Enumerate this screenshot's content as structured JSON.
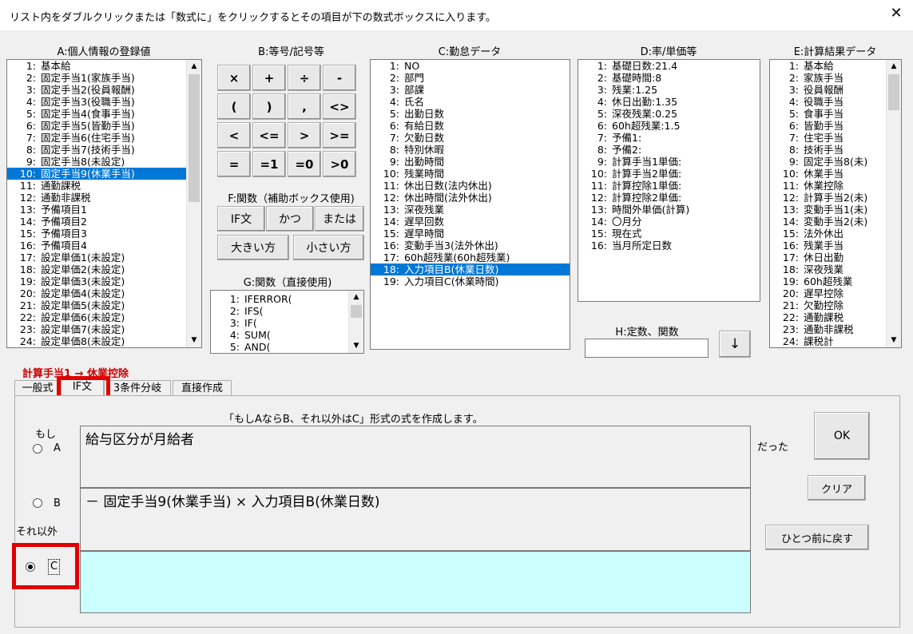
{
  "window": {
    "title": "リスト内をダブルクリックまたは「数式に」をクリックするとその項目が下の数式ボックスに入ります。",
    "close": "✕"
  },
  "headers": {
    "a": "A:個人情報の登録値",
    "b": "B:等号/記号等",
    "c": "C:勤怠データ",
    "d": "D:率/単価等",
    "e": "E:計算結果データ",
    "f": "F:関数（補助ボックス使用)",
    "g": "G:関数（直接使用)",
    "h": "H:定数、関数"
  },
  "list_a": [
    {
      "n": "1:",
      "t": "基本給"
    },
    {
      "n": "2:",
      "t": "固定手当1(家族手当)"
    },
    {
      "n": "3:",
      "t": "固定手当2(役員報酬)"
    },
    {
      "n": "4:",
      "t": "固定手当3(役職手当)"
    },
    {
      "n": "5:",
      "t": "固定手当4(食事手当)"
    },
    {
      "n": "6:",
      "t": "固定手当5(皆勤手当)"
    },
    {
      "n": "7:",
      "t": "固定手当6(住宅手当)"
    },
    {
      "n": "8:",
      "t": "固定手当7(技術手当)"
    },
    {
      "n": "9:",
      "t": "固定手当8(未設定)"
    },
    {
      "n": "10:",
      "t": "固定手当9(休業手当)"
    },
    {
      "n": "11:",
      "t": "通勤課税"
    },
    {
      "n": "12:",
      "t": "通勤非課税"
    },
    {
      "n": "13:",
      "t": "予備項目1"
    },
    {
      "n": "14:",
      "t": "予備項目2"
    },
    {
      "n": "15:",
      "t": "予備項目3"
    },
    {
      "n": "16:",
      "t": "予備項目4"
    },
    {
      "n": "17:",
      "t": "設定単価1(未設定)"
    },
    {
      "n": "18:",
      "t": "設定単価2(未設定)"
    },
    {
      "n": "19:",
      "t": "設定単価3(未設定)"
    },
    {
      "n": "20:",
      "t": "設定単価4(未設定)"
    },
    {
      "n": "21:",
      "t": "設定単価5(未設定)"
    },
    {
      "n": "22:",
      "t": "設定単価6(未設定)"
    },
    {
      "n": "23:",
      "t": "設定単価7(未設定)"
    },
    {
      "n": "24:",
      "t": "設定単価8(未設定)"
    }
  ],
  "list_a_selected": 9,
  "symbol_buttons": [
    "×",
    "+",
    "÷",
    "-",
    "(",
    ")",
    ",",
    "<>",
    "<",
    "<=",
    ">",
    ">=",
    "=",
    "=1",
    "=0",
    ">0"
  ],
  "func_buttons": [
    "IF文",
    "かつ",
    "または",
    "大きい方",
    "小さい方"
  ],
  "list_g": [
    {
      "n": "1:",
      "t": "IFERROR("
    },
    {
      "n": "2:",
      "t": "IFS("
    },
    {
      "n": "3:",
      "t": "IF("
    },
    {
      "n": "4:",
      "t": "SUM("
    },
    {
      "n": "5:",
      "t": "AND("
    }
  ],
  "list_c": [
    {
      "n": "1:",
      "t": "NO"
    },
    {
      "n": "2:",
      "t": "部門"
    },
    {
      "n": "3:",
      "t": "部課"
    },
    {
      "n": "4:",
      "t": "氏名"
    },
    {
      "n": "5:",
      "t": "出勤日数"
    },
    {
      "n": "6:",
      "t": "有給日数"
    },
    {
      "n": "7:",
      "t": "欠勤日数"
    },
    {
      "n": "8:",
      "t": "特別休暇"
    },
    {
      "n": "9:",
      "t": "出勤時間"
    },
    {
      "n": "10:",
      "t": "残業時間"
    },
    {
      "n": "11:",
      "t": "休出日数(法内休出)"
    },
    {
      "n": "12:",
      "t": "休出時間(法外休出)"
    },
    {
      "n": "13:",
      "t": "深夜残業"
    },
    {
      "n": "14:",
      "t": "遅早回数"
    },
    {
      "n": "15:",
      "t": "遅早時間"
    },
    {
      "n": "16:",
      "t": "変動手当3(法外休出)"
    },
    {
      "n": "17:",
      "t": "60h超残業(60h超残業)"
    },
    {
      "n": "18:",
      "t": "入力項目B(休業日数)"
    },
    {
      "n": "19:",
      "t": "入力項目C(休業時間)"
    }
  ],
  "list_c_selected": 17,
  "list_d": [
    {
      "n": "1:",
      "t": "基礎日数:21.4"
    },
    {
      "n": "2:",
      "t": "基礎時間:8"
    },
    {
      "n": "3:",
      "t": "残業:1.25"
    },
    {
      "n": "4:",
      "t": "休日出勤:1.35"
    },
    {
      "n": "5:",
      "t": "深夜残業:0.25"
    },
    {
      "n": "6:",
      "t": "60h超残業:1.5"
    },
    {
      "n": "7:",
      "t": "予備1:"
    },
    {
      "n": "8:",
      "t": "予備2:"
    },
    {
      "n": "9:",
      "t": "計算手当1単価:"
    },
    {
      "n": "10:",
      "t": "計算手当2単価:"
    },
    {
      "n": "11:",
      "t": "計算控除1単価:"
    },
    {
      "n": "12:",
      "t": "計算控除2単価:"
    },
    {
      "n": "13:",
      "t": "時間外単価(計算)"
    },
    {
      "n": "14:",
      "t": "〇月分"
    },
    {
      "n": "15:",
      "t": "現在式"
    },
    {
      "n": "16:",
      "t": "当月所定日数"
    }
  ],
  "list_e": [
    {
      "n": "1:",
      "t": "基本給"
    },
    {
      "n": "2:",
      "t": "家族手当"
    },
    {
      "n": "3:",
      "t": "役員報酬"
    },
    {
      "n": "4:",
      "t": "役職手当"
    },
    {
      "n": "5:",
      "t": "食事手当"
    },
    {
      "n": "6:",
      "t": "皆勤手当"
    },
    {
      "n": "7:",
      "t": "住宅手当"
    },
    {
      "n": "8:",
      "t": "技術手当"
    },
    {
      "n": "9:",
      "t": "固定手当8(未)"
    },
    {
      "n": "10:",
      "t": "休業手当"
    },
    {
      "n": "11:",
      "t": "休業控除"
    },
    {
      "n": "12:",
      "t": "計算手当2(未)"
    },
    {
      "n": "13:",
      "t": "変動手当1(未)"
    },
    {
      "n": "14:",
      "t": "変動手当2(未)"
    },
    {
      "n": "15:",
      "t": "法外休出"
    },
    {
      "n": "16:",
      "t": "残業手当"
    },
    {
      "n": "17:",
      "t": "休日出勤"
    },
    {
      "n": "18:",
      "t": "深夜残業"
    },
    {
      "n": "19:",
      "t": "60h超残業"
    },
    {
      "n": "20:",
      "t": "遅早控除"
    },
    {
      "n": "21:",
      "t": "欠勤控除"
    },
    {
      "n": "22:",
      "t": "通勤課税"
    },
    {
      "n": "23:",
      "t": "通勤非課税"
    },
    {
      "n": "24:",
      "t": "課税計"
    }
  ],
  "h_input": {
    "value": ""
  },
  "h_button": "↓",
  "target_label": "計算手当1 → 休業控除",
  "tabs": [
    "一般式",
    "IF文",
    "3条件分岐",
    "直接作成"
  ],
  "active_tab": 1,
  "if_panel": {
    "description": "「もしAならB、それ以外はC」形式の式を作成します。",
    "moshi": "もし",
    "radio_a": "A",
    "radio_b": "B",
    "soreigai": "それ以外",
    "radio_c": "C",
    "datta": "だった",
    "box_a": "給与区分が月給者",
    "box_b": "－ 固定手当9(休業手当) × 入力項目B(休業日数)",
    "box_c": "",
    "selected_radio": "C"
  },
  "buttons": {
    "ok": "OK",
    "clear": "クリア",
    "undo": "ひとつ前に戻す"
  },
  "colors": {
    "selection": "#0078d7",
    "highlight_box": "#e00000",
    "active_input": "#ccffff",
    "target_label": "#cc0000"
  }
}
